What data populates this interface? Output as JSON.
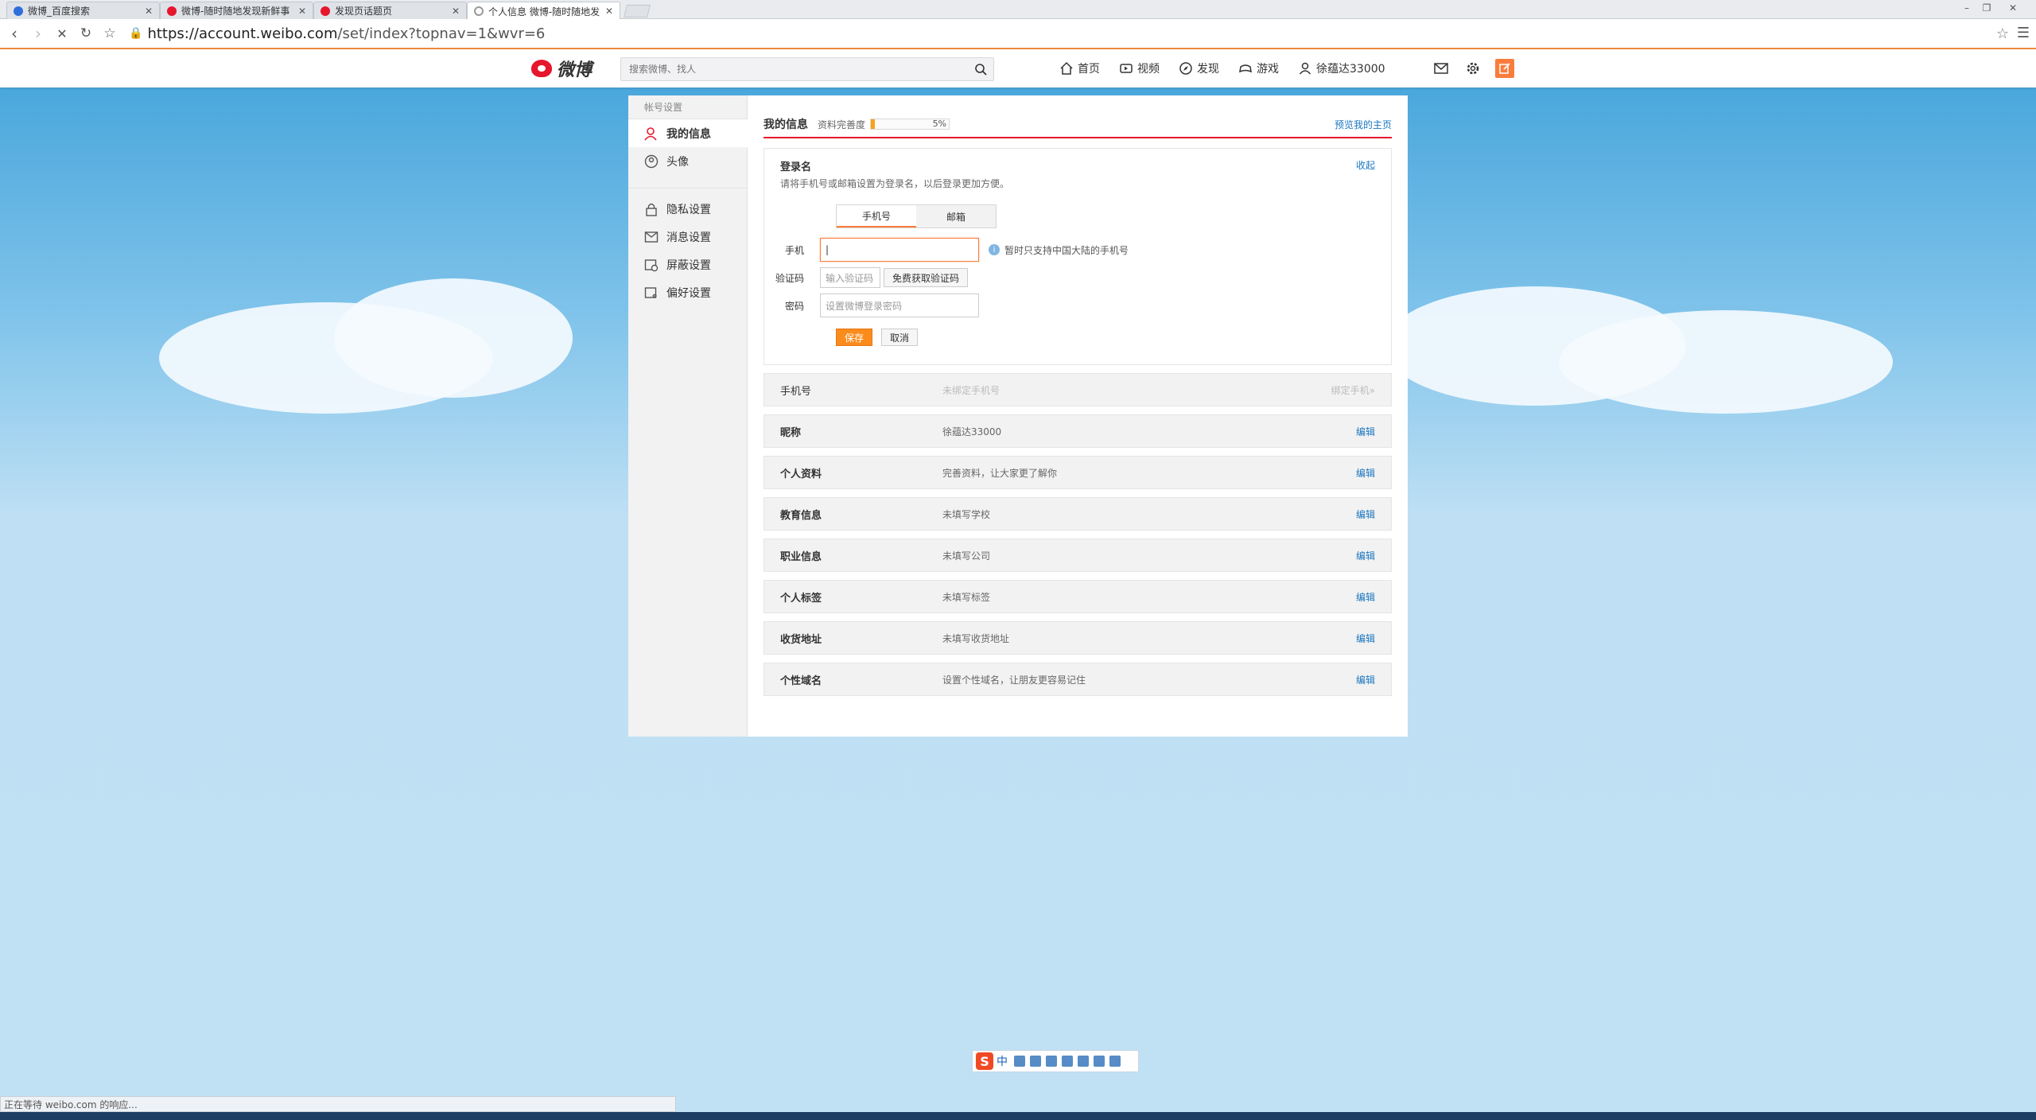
{
  "browser": {
    "tabs": [
      {
        "title": "微博_百度搜索",
        "favicon_color": "#2f6fdb",
        "active": false
      },
      {
        "title": "微博-随时随地发现新鲜事",
        "favicon_color": "#e6162d",
        "active": false
      },
      {
        "title": "发现页话题页",
        "favicon_color": "#e6162d",
        "active": false
      },
      {
        "title": "个人信息 微博-随时随地发",
        "favicon_color": "#999999",
        "active": true
      }
    ],
    "url_host": "https://account.weibo.com",
    "url_path": "/set/index?topnav=1&wvr=6",
    "status_text": "正在等待 weibo.com 的响应..."
  },
  "weibo_nav": {
    "logo_text": "微博",
    "search_placeholder": "搜索微博、找人",
    "links": [
      "首页",
      "视频",
      "发现",
      "游戏",
      "徐蕴达33000"
    ],
    "brand_color": "#e6162d",
    "accent_color": "#fa7d3c"
  },
  "sidebar": {
    "title": "帐号设置",
    "items": [
      "我的信息",
      "头像",
      "隐私设置",
      "消息设置",
      "屏蔽设置",
      "偏好设置"
    ]
  },
  "main": {
    "title": "我的信息",
    "progress_label": "资料完善度",
    "progress_percent": 5,
    "progress_text": "5%",
    "preview_link": "预览我的主页",
    "login": {
      "title": "登录名",
      "desc": "请将手机号或邮箱设置为登录名，以后登录更加方便。",
      "collapse": "收起",
      "tabs": [
        "手机号",
        "邮箱"
      ],
      "phone_label": "手机",
      "phone_value": "|",
      "phone_hint": "暂时只支持中国大陆的手机号",
      "code_label": "验证码",
      "code_placeholder": "输入验证码",
      "code_button": "免费获取验证码",
      "password_label": "密码",
      "password_placeholder": "设置微博登录密码",
      "save": "保存",
      "cancel": "取消"
    },
    "rows": [
      {
        "label": "手机号",
        "value": "未绑定手机号",
        "action": "绑定手机»"
      },
      {
        "label": "昵称",
        "value": "徐蕴达33000",
        "action": "编辑"
      },
      {
        "label": "个人资料",
        "value": "完善资料，让大家更了解你",
        "action": "编辑"
      },
      {
        "label": "教育信息",
        "value": "未填写学校",
        "action": "编辑"
      },
      {
        "label": "职业信息",
        "value": "未填写公司",
        "action": "编辑"
      },
      {
        "label": "个人标签",
        "value": "未填写标签",
        "action": "编辑"
      },
      {
        "label": "收货地址",
        "value": "未填写收货地址",
        "action": "编辑"
      },
      {
        "label": "个性域名",
        "value": "设置个性域名，让朋友更容易记住",
        "action": "编辑"
      }
    ]
  },
  "ime": {
    "logo": "S",
    "mode": "中"
  }
}
